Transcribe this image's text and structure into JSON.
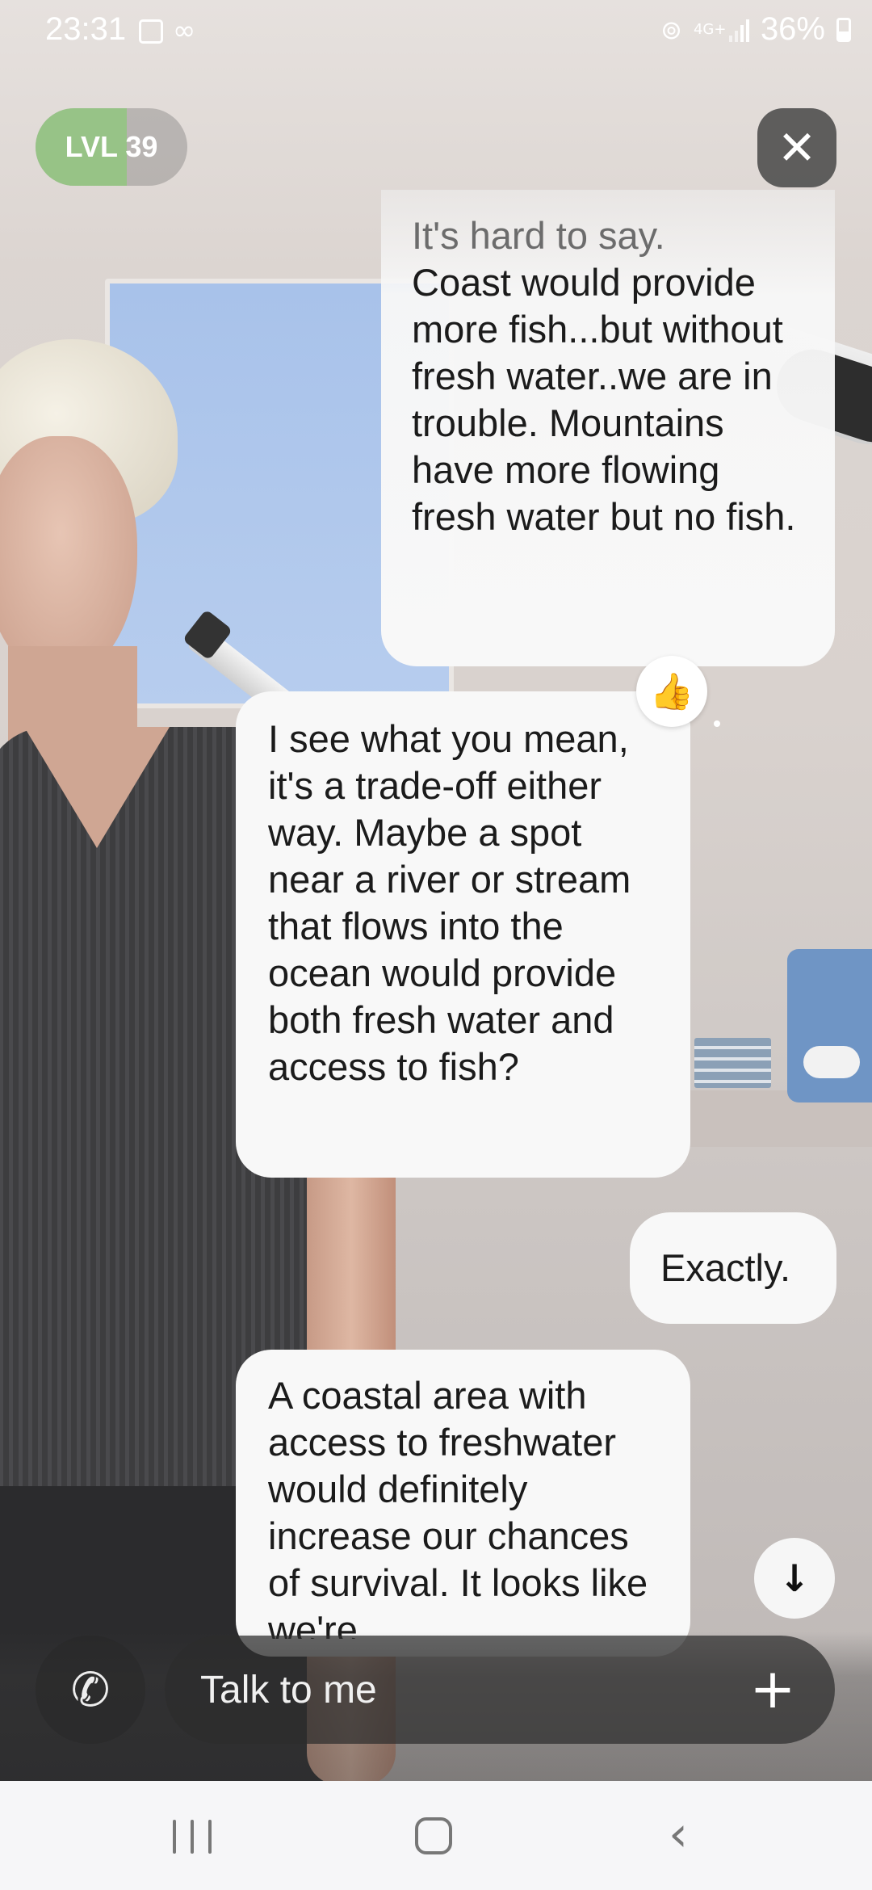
{
  "status_bar": {
    "time": "23:31",
    "network": "4G+",
    "battery_percent": "36%"
  },
  "level": {
    "label": "LVL 39",
    "progress_fraction": 0.6
  },
  "chat": {
    "messages": [
      {
        "sender": "user",
        "text_faded": "It's hard to say.",
        "text": "Coast would provide more fish...but without fresh water..we are in trouble. Mountains have more flowing fresh water but no fish."
      },
      {
        "sender": "bot",
        "text": "I see what you mean, it's a trade-off either way. Maybe a spot near a river or stream that flows into the ocean would provide both fresh water and access to fish?",
        "reaction": "👍"
      },
      {
        "sender": "user",
        "text": "Exactly."
      },
      {
        "sender": "bot",
        "text": "A coastal area with access to freshwater would definitely increase our chances of survival. It looks like we're"
      }
    ]
  },
  "input": {
    "placeholder": "Talk to me"
  },
  "icons": {
    "close": "close-icon",
    "scroll_down": "arrow-down-icon",
    "call": "phone-icon",
    "add": "plus-icon",
    "reaction": "thumbs-up-icon"
  },
  "colors": {
    "bubble": "#f8f8f8",
    "level_fill": "#8cc878",
    "input_bar": "#2d2d2d",
    "navbar": "#f6f6f8"
  }
}
